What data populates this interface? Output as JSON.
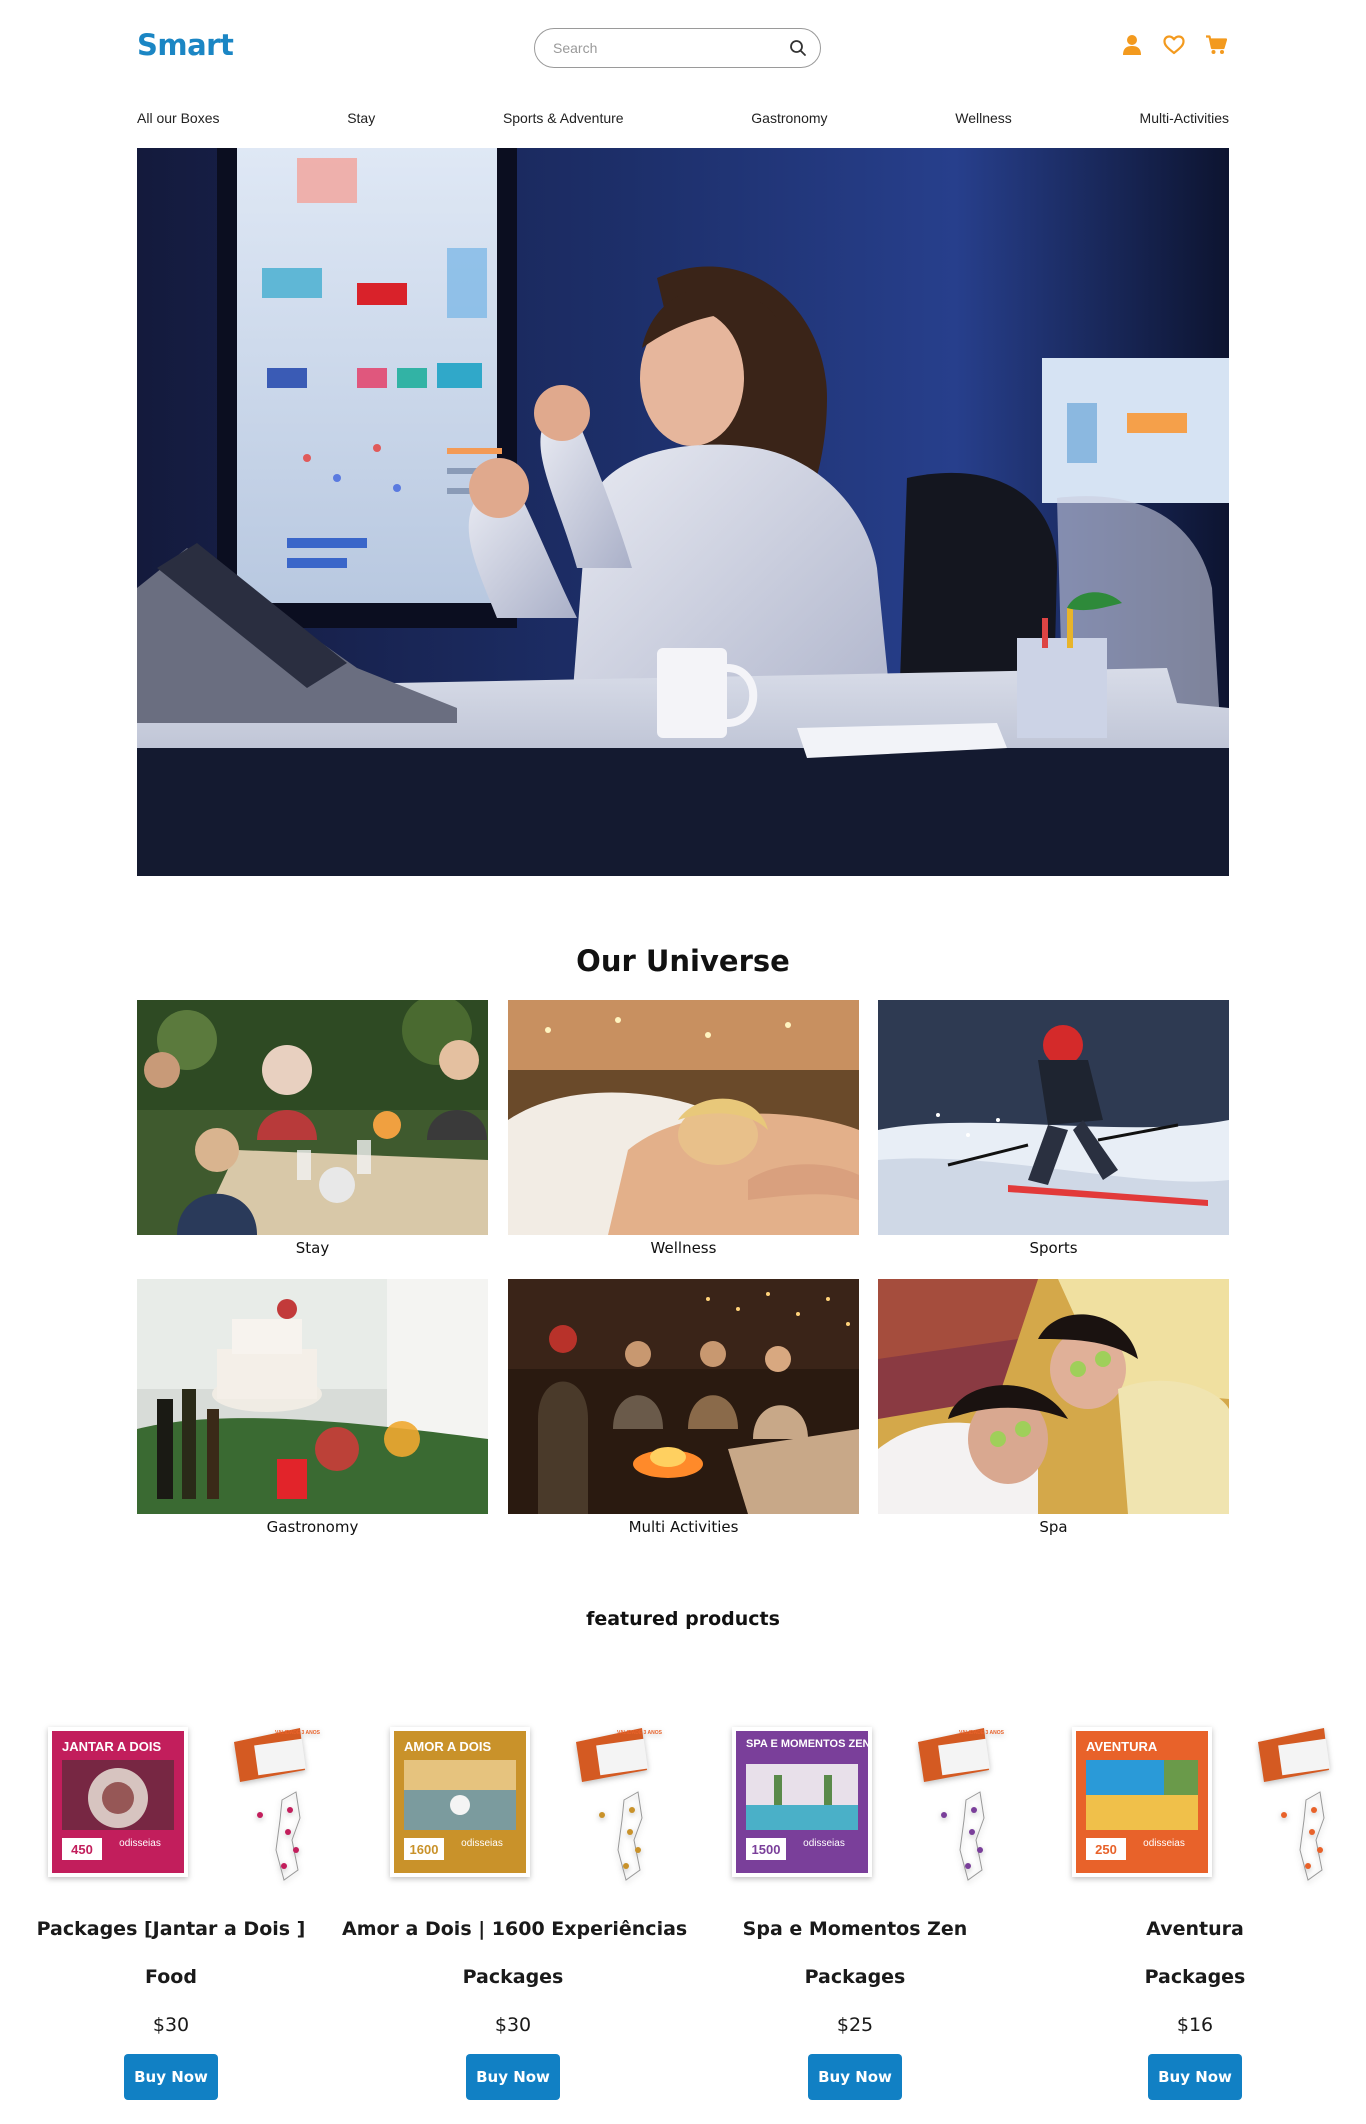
{
  "brand": {
    "logo": "Smart",
    "accent": "#1b86c4",
    "icon_color": "#f39a1e"
  },
  "search": {
    "placeholder": "Search"
  },
  "header_icons": [
    "user-icon",
    "heart-icon",
    "cart-icon"
  ],
  "nav": {
    "items": [
      "All our Boxes",
      "Stay",
      "Sports & Adventure",
      "Gastronomy",
      "Wellness",
      "Multi-Activities"
    ]
  },
  "universe": {
    "title": "Our Universe",
    "tiles": [
      {
        "label": "Stay"
      },
      {
        "label": "Wellness"
      },
      {
        "label": "Sports"
      },
      {
        "label": "Gastronomy"
      },
      {
        "label": "Multi Activities"
      },
      {
        "label": "Spa"
      }
    ]
  },
  "featured": {
    "title": "featured products",
    "buy_label": "Buy Now",
    "box_brand": "odisseias",
    "box_badge": "VALIDADE 3 ANOS",
    "products": [
      {
        "name": "Packages [Jantar a Dois ]",
        "category": "Food",
        "price": "$30",
        "box_title": "JANTAR A DOIS",
        "box_number": "450",
        "box_color": "#c21e5c"
      },
      {
        "name": "Amor a Dois | 1600 Experiências",
        "category": "Packages",
        "price": "$30",
        "box_title": "AMOR A DOIS",
        "box_number": "1600",
        "box_color": "#c9922a"
      },
      {
        "name": "Spa e Momentos Zen",
        "category": "Packages",
        "price": "$25",
        "box_title": "SPA E MOMENTOS ZEN",
        "box_number": "1500",
        "box_color": "#7a3f9a"
      },
      {
        "name": "Aventura",
        "category": "Packages",
        "price": "$16",
        "box_title": "AVENTURA",
        "box_number": "250",
        "box_color": "#e8622a"
      }
    ]
  }
}
